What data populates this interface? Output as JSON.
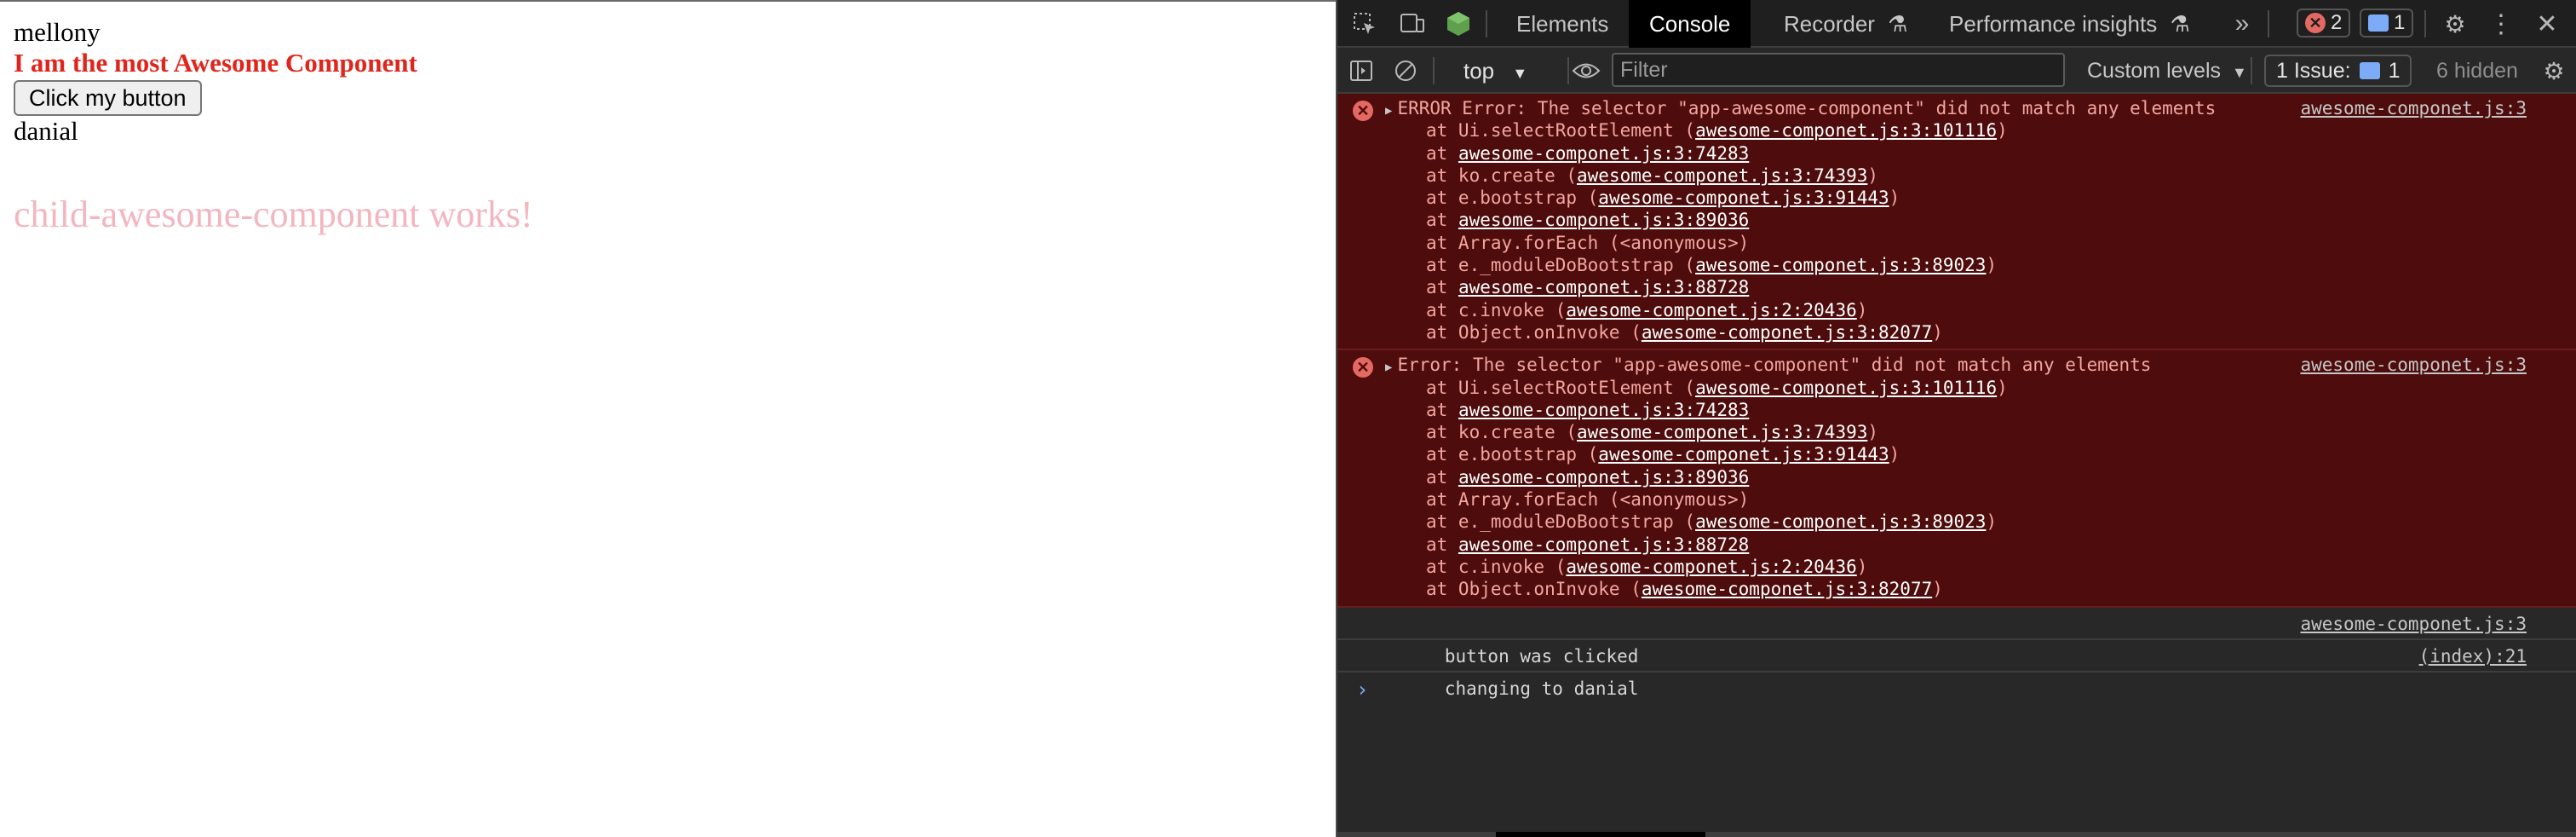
{
  "page": {
    "name_text": "mellony",
    "heading": "I am the most Awesome Component",
    "button_label": "Click my button",
    "name_text_2": "danial",
    "child_text": "child-awesome-component works!"
  },
  "devtools": {
    "tabs": [
      "Elements",
      "Console",
      "Recorder",
      "Performance insights"
    ],
    "active_tab": "Console",
    "error_count": "2",
    "message_count": "1",
    "toolbar": {
      "context": "top",
      "filter_placeholder": "Filter",
      "levels_label": "Custom levels",
      "issues_label": "1 Issue:",
      "issues_count": "1",
      "hidden_label": "6 hidden"
    },
    "errors": [
      {
        "message": "ERROR Error: The selector \"app-awesome-component\" did not match any elements",
        "source": "awesome-componet.js:3",
        "stack": [
          {
            "prefix": "at Ui.selectRootElement (",
            "link": "awesome-componet.js:3:101116",
            "suffix": ")"
          },
          {
            "prefix": "at ",
            "link": "awesome-componet.js:3:74283",
            "suffix": ""
          },
          {
            "prefix": "at ko.create (",
            "link": "awesome-componet.js:3:74393",
            "suffix": ")"
          },
          {
            "prefix": "at e.bootstrap (",
            "link": "awesome-componet.js:3:91443",
            "suffix": ")"
          },
          {
            "prefix": "at ",
            "link": "awesome-componet.js:3:89036",
            "suffix": ""
          },
          {
            "prefix": "at Array.forEach (<anonymous>)",
            "link": "",
            "suffix": ""
          },
          {
            "prefix": "at e._moduleDoBootstrap (",
            "link": "awesome-componet.js:3:89023",
            "suffix": ")"
          },
          {
            "prefix": "at ",
            "link": "awesome-componet.js:3:88728",
            "suffix": ""
          },
          {
            "prefix": "at c.invoke (",
            "link": "awesome-componet.js:2:20436",
            "suffix": ")"
          },
          {
            "prefix": "at Object.onInvoke (",
            "link": "awesome-componet.js:3:82077",
            "suffix": ")"
          }
        ]
      },
      {
        "message": "Error: The selector \"app-awesome-component\" did not match any elements",
        "source": "awesome-componet.js:3",
        "stack": [
          {
            "prefix": "at Ui.selectRootElement (",
            "link": "awesome-componet.js:3:101116",
            "suffix": ")"
          },
          {
            "prefix": "at ",
            "link": "awesome-componet.js:3:74283",
            "suffix": ""
          },
          {
            "prefix": "at ko.create (",
            "link": "awesome-componet.js:3:74393",
            "suffix": ")"
          },
          {
            "prefix": "at e.bootstrap (",
            "link": "awesome-componet.js:3:91443",
            "suffix": ")"
          },
          {
            "prefix": "at ",
            "link": "awesome-componet.js:3:89036",
            "suffix": ""
          },
          {
            "prefix": "at Array.forEach (<anonymous>)",
            "link": "",
            "suffix": ""
          },
          {
            "prefix": "at e._moduleDoBootstrap (",
            "link": "awesome-componet.js:3:89023",
            "suffix": ")"
          },
          {
            "prefix": "at ",
            "link": "awesome-componet.js:3:88728",
            "suffix": ""
          },
          {
            "prefix": "at c.invoke (",
            "link": "awesome-componet.js:2:20436",
            "suffix": ")"
          },
          {
            "prefix": "at Object.onInvoke (",
            "link": "awesome-componet.js:3:82077",
            "suffix": ")"
          }
        ]
      }
    ],
    "logs": [
      {
        "text": "button was clicked",
        "source": "awesome-componet.js:3"
      },
      {
        "text": "changing to danial",
        "source": "(index):21"
      }
    ],
    "prompt_symbol": "›",
    "colors": {
      "error_bg": "#4e0c0c",
      "error_text": "#f3a6a0",
      "panel_bg": "#282828",
      "heading_red": "#e0261c",
      "child_pink": "#f3b6c0"
    }
  }
}
